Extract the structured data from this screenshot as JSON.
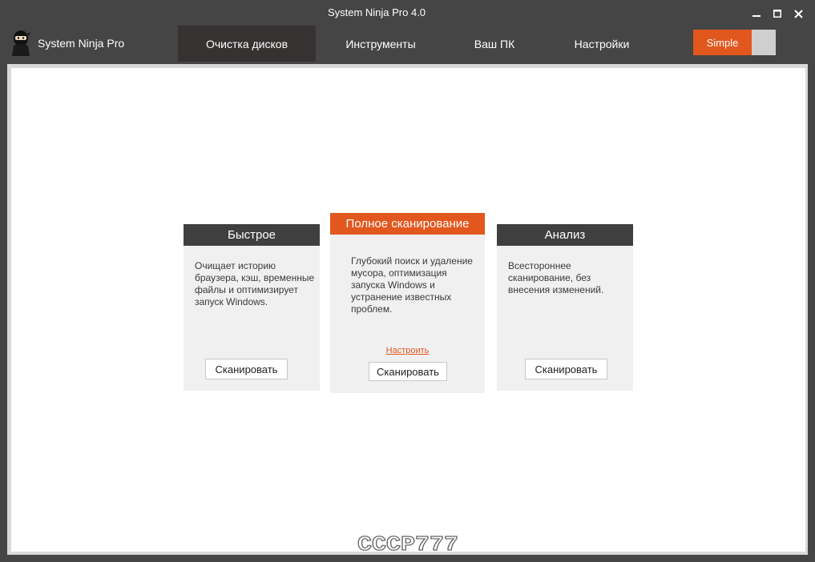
{
  "window": {
    "title": "System Ninja Pro 4.0"
  },
  "app": {
    "name": "System Ninja Pro"
  },
  "nav": {
    "tabs": [
      {
        "label": "Очистка дисков",
        "active": true
      },
      {
        "label": "Инструменты",
        "active": false
      },
      {
        "label": "Ваш ПК",
        "active": false
      },
      {
        "label": "Настройки",
        "active": false
      }
    ]
  },
  "mode": {
    "simple_label": "Simple"
  },
  "cards": {
    "quick": {
      "title": "Быстрое",
      "description": "Очищает историю браузера, кэш, временные файлы и оптимизирует запуск Windows.",
      "button": "Сканировать"
    },
    "full": {
      "title": "Полное сканирование",
      "description": "Глубокий поиск и удаление мусора, оптимизация запуска Windows и устранение известных проблем.",
      "link": "Настроить",
      "button": "Сканировать"
    },
    "analysis": {
      "title": "Анализ",
      "description": "Всестороннее сканирование, без внесения изменений.",
      "button": "Сканировать"
    }
  },
  "watermark": {
    "text": "CCCP777"
  },
  "colors": {
    "accent": "#e2571e",
    "chrome": "#454545",
    "active_tab": "#363231",
    "card_header": "#3f3f3f",
    "card_body": "#f0f0f0"
  },
  "icons": {
    "logo": "ninja-icon",
    "minimize": "minimize-icon",
    "maximize": "maximize-icon",
    "close": "close-icon"
  }
}
